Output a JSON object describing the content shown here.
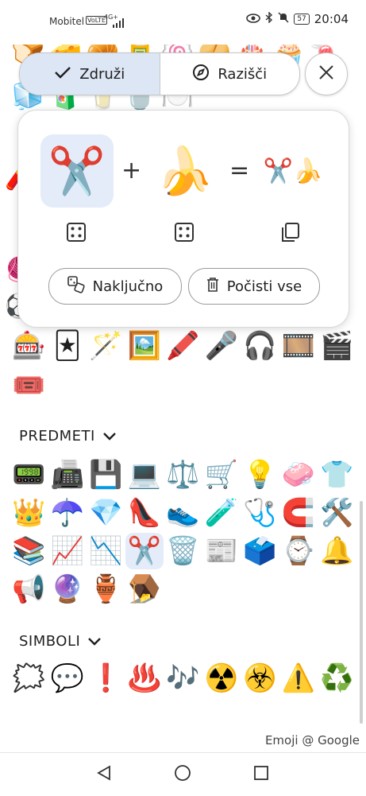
{
  "status_bar": {
    "carrier": "Mobitel",
    "volte_badge": "VoLTE",
    "network": "4G+",
    "battery": "57",
    "time": "20:04"
  },
  "tabs": {
    "combine_label": "Združi",
    "explore_label": "Razišči"
  },
  "mixer": {
    "first_emoji": "✂️",
    "second_emoji": "🍌",
    "result_emoji": "✂️🍌",
    "plus": "+",
    "equals": "=",
    "random_label": "Naključno",
    "clear_label": "Počisti vse"
  },
  "background_rows": [
    [
      "🍞",
      "🧀",
      "🥐",
      "🥫",
      "🍥",
      "🥠",
      "🎂",
      "🧁",
      "🍬"
    ],
    [
      "🧊",
      "🧃",
      "🥛",
      "🍵",
      "🍽️",
      "",
      "",
      "",
      ""
    ]
  ],
  "background_left_partial": [
    "🧨",
    "🧶",
    "⚽"
  ],
  "entertainment_rows": [
    [
      "🎰",
      "🃏",
      "🪄",
      "🖼️",
      "🖍️",
      "🎤",
      "🎧",
      "🎞️",
      "🎬"
    ],
    [
      "🎟️"
    ]
  ],
  "sections": {
    "objects_title": "PREDMETI",
    "symbols_title": "SIMBOLI"
  },
  "objects_rows": [
    [
      "📟",
      "📠",
      "💾",
      "💻",
      "⚖️",
      "🛒",
      "💡",
      "🧼",
      "👕"
    ],
    [
      "👑",
      "☂️",
      "💎",
      "👠",
      "👟",
      "🧪",
      "🩺",
      "🧲",
      "🛠️"
    ],
    [
      "📚",
      "📈",
      "📉",
      "✂️",
      "🗑️",
      "📰",
      "🗳️",
      "⌚",
      "🔔"
    ],
    [
      "📢",
      "🔮",
      "🏺",
      "🪤"
    ]
  ],
  "symbols_rows": [
    [
      "🗯️",
      "💬",
      "❗",
      "♨️",
      "🎶",
      "☢️",
      "☣️",
      "⚠️",
      "♻️"
    ]
  ],
  "credit": "Emoji @ Google"
}
